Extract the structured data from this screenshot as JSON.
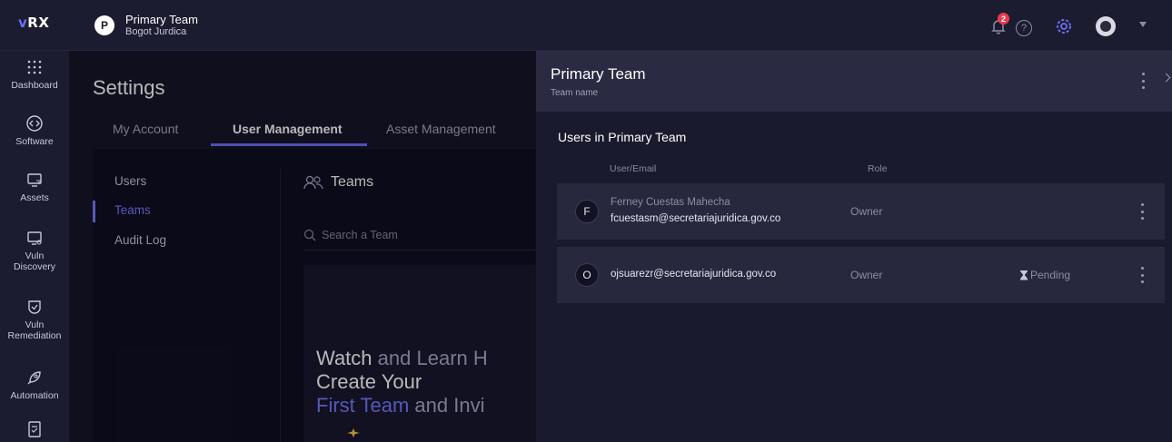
{
  "app": {
    "logo_prefix": "v",
    "logo_rest": "RX"
  },
  "header": {
    "team_initial": "P",
    "team_name": "Primary Team",
    "team_subtitle": "Bogot Jurdica",
    "notifications_count": "2"
  },
  "sidebar": {
    "items": [
      {
        "label": "Dashboard",
        "icon": "grid-dots-icon"
      },
      {
        "label": "Software",
        "icon": "code-icon"
      },
      {
        "label": "Assets",
        "icon": "monitor-icon"
      },
      {
        "label": "Vuln",
        "label2": "Discovery",
        "icon": "monitor-search-icon"
      },
      {
        "label": "Vuln",
        "label2": "Remediation",
        "icon": "shield-check-icon"
      },
      {
        "label": "Automation",
        "icon": "rocket-icon"
      }
    ]
  },
  "settings": {
    "title": "Settings",
    "tabs": [
      "My Account",
      "User Management",
      "Asset Management"
    ],
    "active_tab": "User Management",
    "menu": [
      "Users",
      "Teams",
      "Audit Log"
    ],
    "active_menu": "Teams",
    "section_title": "Teams",
    "search_placeholder": "Search a Team",
    "promo": {
      "line1a": "Watch",
      "line1b": "and",
      "line1c": "Learn H",
      "line2": "Create Your",
      "line3a": "First Team",
      "line3b": "and Invi"
    }
  },
  "panel": {
    "title": "Primary Team",
    "subtitle": "Team name",
    "users_title": "Users in Primary Team",
    "columns": {
      "user": "User/Email",
      "role": "Role"
    },
    "users": [
      {
        "initial": "F",
        "name": "Ferney Cuestas Mahecha",
        "email": "fcuestasm@secretariajuridica.gov.co",
        "role": "Owner",
        "status": ""
      },
      {
        "initial": "O",
        "name": "",
        "email": "ojsuarezr@secretariajuridica.gov.co",
        "role": "Owner",
        "status": "Pending"
      }
    ]
  },
  "colors": {
    "accent": "#6d6df5",
    "badge": "#e63b4d",
    "panel_header": "#2a2a42"
  }
}
